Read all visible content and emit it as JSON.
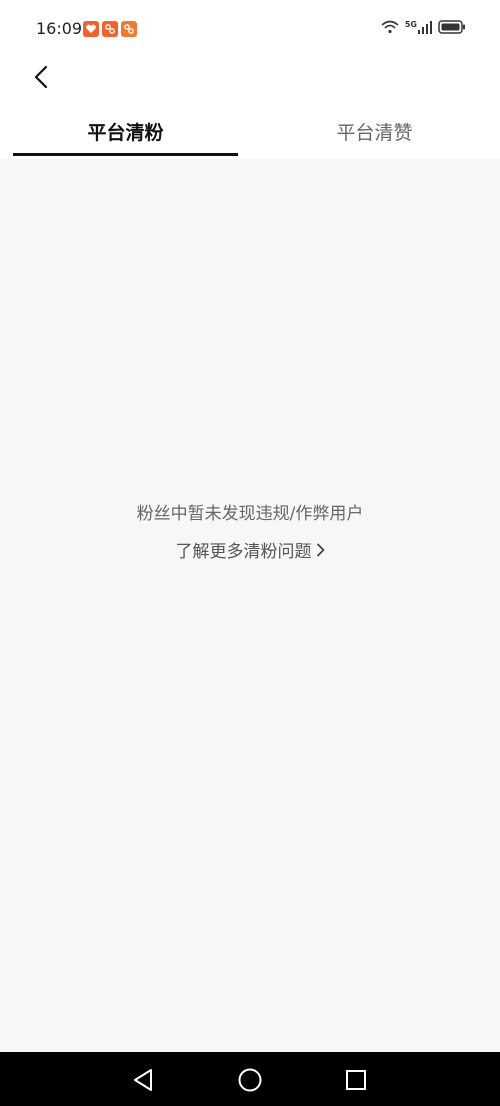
{
  "status_bar": {
    "time": "16:09",
    "notification_icons": [
      "heart-badge-icon",
      "app-logo-icon",
      "app-logo-icon"
    ],
    "network": "5G",
    "system_icons": [
      "wifi-icon",
      "5g-signal-icon",
      "battery-icon"
    ]
  },
  "header": {
    "back_icon": "chevron-left-icon"
  },
  "tabs": [
    {
      "label": "平台清粉",
      "active": true
    },
    {
      "label": "平台清赞",
      "active": false
    }
  ],
  "empty_state": {
    "message": "粉丝中暂未发现违规/作弊用户",
    "link_label": "了解更多清粉问题"
  },
  "nav_bar": {
    "buttons": [
      "back-triangle-icon",
      "home-circle-icon",
      "recents-square-icon"
    ]
  },
  "colors": {
    "background": "#f7f7f7",
    "header_bg": "#ffffff",
    "nav_bar": "#000000",
    "notif_orange": "#f0622d",
    "active_tab": "#111111",
    "inactive_tab": "#666666"
  }
}
